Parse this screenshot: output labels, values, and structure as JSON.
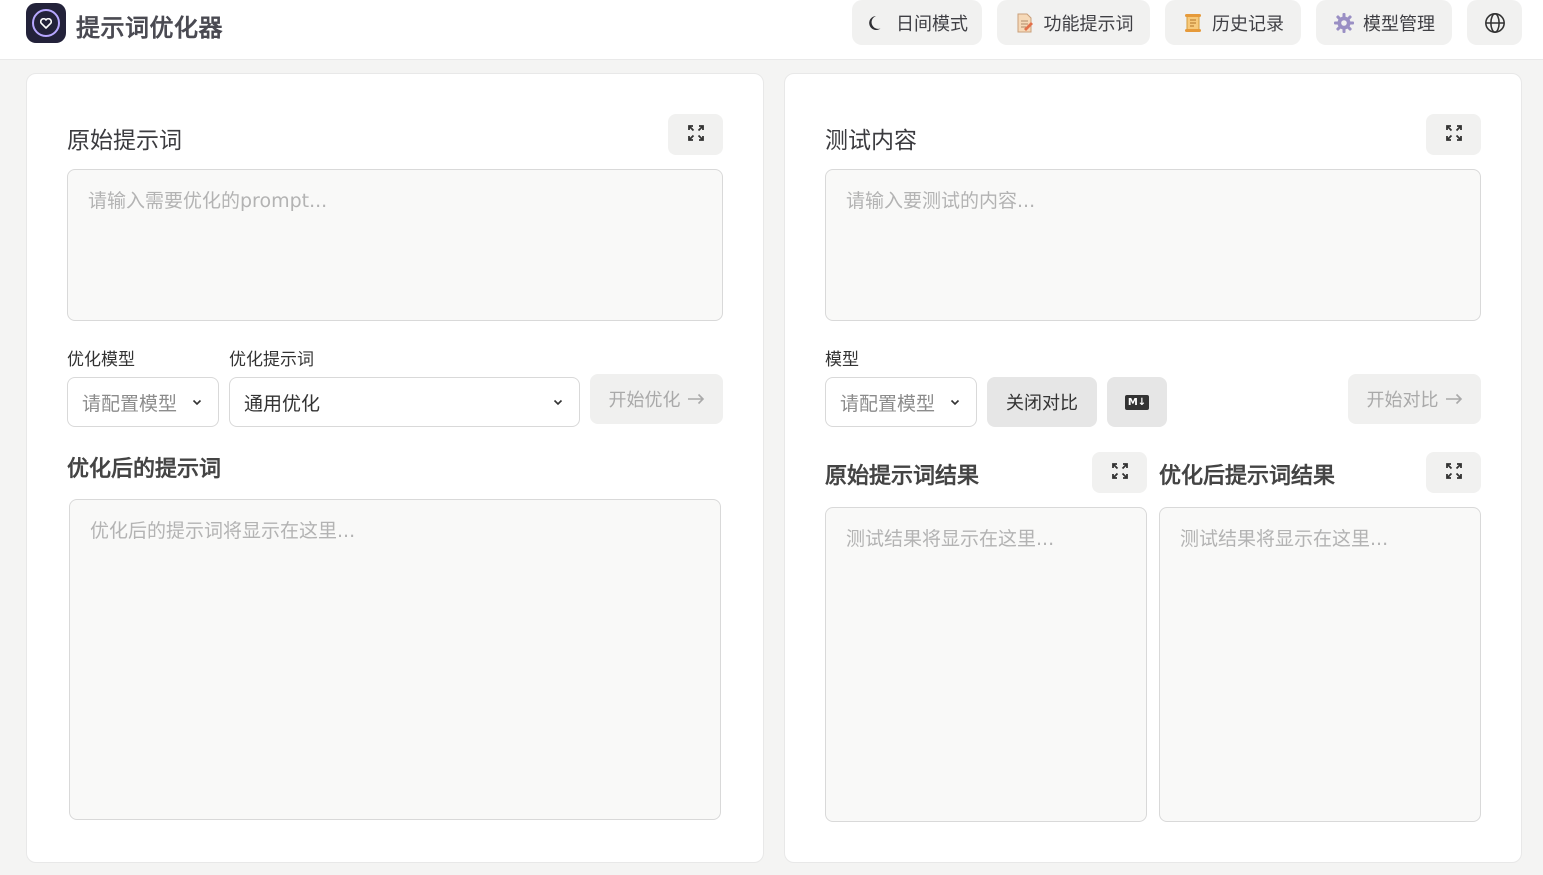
{
  "app": {
    "title": "提示词优化器",
    "logo_icon": "heart-icon"
  },
  "header": {
    "day_mode": "日间模式",
    "func_prompts": "功能提示词",
    "history": "历史记录",
    "model_manage": "模型管理",
    "icons": {
      "day_mode": "moon-icon",
      "func_prompts": "document-icon",
      "history": "scroll-icon",
      "model_manage": "gear-icon",
      "language": "globe-icon"
    }
  },
  "left": {
    "original_title": "原始提示词",
    "original_placeholder": "请输入需要优化的prompt...",
    "opt_model_label": "优化模型",
    "opt_model_value": "请配置模型",
    "opt_prompt_label": "优化提示词",
    "opt_prompt_value": "通用优化",
    "start_optimize": "开始优化",
    "optimized_title": "优化后的提示词",
    "optimized_placeholder": "优化后的提示词将显示在这里..."
  },
  "right": {
    "test_title": "测试内容",
    "test_placeholder": "请输入要测试的内容...",
    "model_label": "模型",
    "model_value": "请配置模型",
    "close_compare": "关闭对比",
    "markdown_badge": "M↓",
    "start_compare": "开始对比",
    "original_result_title": "原始提示词结果",
    "optimized_result_title": "优化后提示词结果",
    "result_placeholder": "测试结果将显示在这里..."
  },
  "colors": {
    "page_bg": "#f4f4f3",
    "card_bg": "#ffffff",
    "button_bg": "#f1f1f0",
    "logo_bg": "#23223a",
    "logo_accent": "#b7a7ff"
  }
}
